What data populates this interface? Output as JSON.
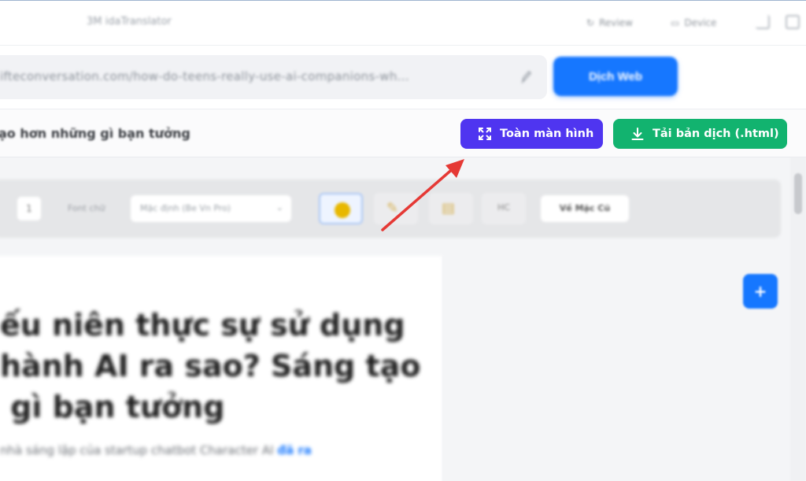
{
  "window": {
    "app_title": "3M idaTranslator",
    "review_label": "Review",
    "device_label": "Device",
    "icons": [
      "expand-icon",
      "window-icon"
    ]
  },
  "url_bar": {
    "value": "ifteconversation.com/how-do-teens-really-use-ai-companions-wh...",
    "translate_button": "Dịch Web"
  },
  "action_bar": {
    "doc_title": "ạo hơn những gì bạn tưởng",
    "fullscreen_button": "Toàn màn hình",
    "download_button": "Tải bản dịch (.html)",
    "colors": {
      "fullscreen": "#4f35f0",
      "download": "#12b36f",
      "accent": "#1677ff",
      "annotation": "#e53935"
    }
  },
  "toolbar": {
    "font_size_value": "1",
    "font_label": "Font chữ",
    "font_select_value": "Mặc định (Be Vn Pro)",
    "theme_chips": [
      {
        "name": "sun",
        "active": true
      },
      {
        "name": "sepia",
        "active": false
      },
      {
        "name": "paper",
        "active": false
      },
      {
        "name": "contrast",
        "label": "HC",
        "active": false
      }
    ],
    "reset_label": "Về Mặc Cũ"
  },
  "article": {
    "headline": "ếu niên thực sự sử dụng\nhành AI ra sao? Sáng tạo\n gì bạn tưởng",
    "lead_text": "nhà sáng lập của startup chatbot Character AI ",
    "lead_link": "đã ra",
    "floating_button": "+"
  }
}
